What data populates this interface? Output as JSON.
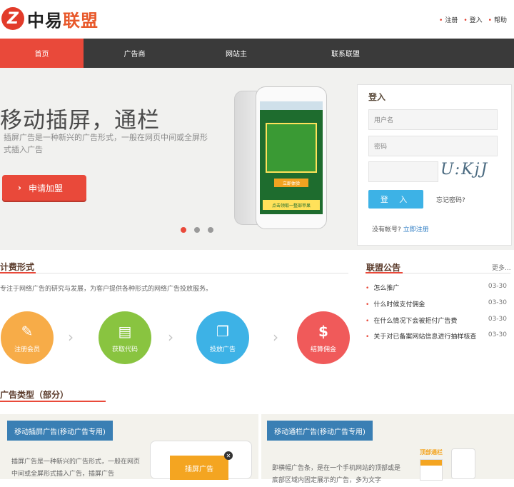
{
  "brand": {
    "logo_letter": "Z",
    "name_part1": "中易",
    "name_part2": "联盟"
  },
  "toplinks": [
    "注册",
    "登入",
    "帮助"
  ],
  "nav": [
    {
      "label": "首页",
      "active": true
    },
    {
      "label": "广告商",
      "active": false
    },
    {
      "label": "网站主",
      "active": false
    },
    {
      "label": "联系联盟",
      "active": false
    }
  ],
  "banner": {
    "title": "移动插屏，通栏",
    "subtitle": "插屏广告是一种新兴的广告形式，一般在网页中间或全屏形式插入广告",
    "cta": "申请加盟",
    "phone_screen_label": "立即体验",
    "phone_banner_text": "点击领取一整部苹果",
    "slides": 3,
    "active_slide": 0
  },
  "login": {
    "title": "登入",
    "username_placeholder": "用户名",
    "password_placeholder": "密码",
    "captcha_text": "U:KjJ",
    "button": "登 入",
    "forgot": "忘记密码?",
    "no_account": "没有帐号?",
    "register": "立即注册"
  },
  "fee": {
    "title": "计费形式",
    "desc": "专注于网络广告的研究与发展，为客户提供各种形式的网络广告投放服务。",
    "steps": [
      {
        "label": "注册会员",
        "icon": "pencil-icon",
        "color": "#f7ac48"
      },
      {
        "label": "获取代码",
        "icon": "code-document-icon",
        "color": "#89c440"
      },
      {
        "label": "投放广告",
        "icon": "window-icon",
        "color": "#3db2e6"
      },
      {
        "label": "结算佣金",
        "icon": "dollar-icon",
        "color": "#f05a5a"
      }
    ]
  },
  "notice": {
    "title": "联盟公告",
    "more": "更多...",
    "items": [
      {
        "text": "怎么推广",
        "date": "03-30"
      },
      {
        "text": "什么时候支付佣金",
        "date": "03-30"
      },
      {
        "text": "在什么情况下会被拒付广告费",
        "date": "03-30"
      },
      {
        "text": "关于对已备案网站信息进行抽样核查",
        "date": "03-30"
      }
    ]
  },
  "adtypes": {
    "title": "广告类型（部分）",
    "items": [
      {
        "tag": "移动插屏广告(移动广告专用)",
        "desc": "插屏广告是一种新兴的广告形式，一般在网页中间或全屏形式插入广告，插屏广告",
        "promo_label": "插屏广告"
      },
      {
        "tag": "移动通栏广告(移动广告专用)",
        "desc": "即横幅广告条，是在一个手机网站的顶部或是底部区域内固定展示的广告，多为文字",
        "promo_label": "顶部通栏"
      }
    ]
  }
}
